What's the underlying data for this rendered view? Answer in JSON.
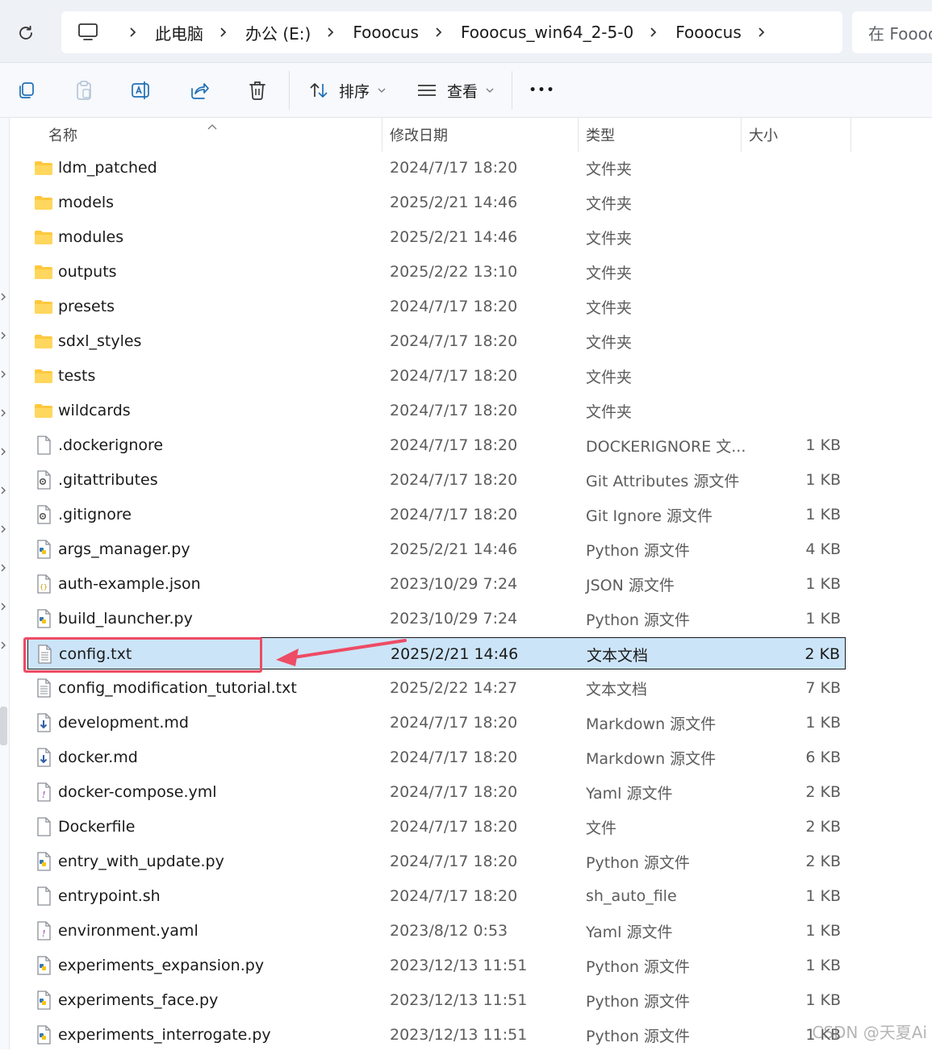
{
  "address_bar": {
    "crumbs": [
      "此电脑",
      "办公 (E:)",
      "Fooocus",
      "Fooocus_win64_2-5-0",
      "Fooocus"
    ],
    "search_placeholder": "在 Fooocus 中搜索"
  },
  "toolbar": {
    "sort_label": "排序",
    "view_label": "查看",
    "more_label": "•••"
  },
  "columns": {
    "name": "名称",
    "date": "修改日期",
    "type": "类型",
    "size": "大小"
  },
  "files": [
    {
      "name": "ldm_patched",
      "date": "2024/7/17 18:20",
      "type": "文件夹",
      "size": "",
      "icon": "folder-icon"
    },
    {
      "name": "models",
      "date": "2025/2/21 14:46",
      "type": "文件夹",
      "size": "",
      "icon": "folder-icon"
    },
    {
      "name": "modules",
      "date": "2025/2/21 14:46",
      "type": "文件夹",
      "size": "",
      "icon": "folder-icon"
    },
    {
      "name": "outputs",
      "date": "2025/2/22 13:10",
      "type": "文件夹",
      "size": "",
      "icon": "folder-icon"
    },
    {
      "name": "presets",
      "date": "2024/7/17 18:20",
      "type": "文件夹",
      "size": "",
      "icon": "folder-icon"
    },
    {
      "name": "sdxl_styles",
      "date": "2024/7/17 18:20",
      "type": "文件夹",
      "size": "",
      "icon": "folder-icon"
    },
    {
      "name": "tests",
      "date": "2024/7/17 18:20",
      "type": "文件夹",
      "size": "",
      "icon": "folder-icon"
    },
    {
      "name": "wildcards",
      "date": "2024/7/17 18:20",
      "type": "文件夹",
      "size": "",
      "icon": "folder-icon"
    },
    {
      "name": ".dockerignore",
      "date": "2024/7/17 18:20",
      "type": "DOCKERIGNORE 文...",
      "size": "1 KB",
      "icon": "blank-file-icon"
    },
    {
      "name": ".gitattributes",
      "date": "2024/7/17 18:20",
      "type": "Git Attributes 源文件",
      "size": "1 KB",
      "icon": "gear-file-icon"
    },
    {
      "name": ".gitignore",
      "date": "2024/7/17 18:20",
      "type": "Git Ignore 源文件",
      "size": "1 KB",
      "icon": "gear-file-icon"
    },
    {
      "name": "args_manager.py",
      "date": "2025/2/21 14:46",
      "type": "Python 源文件",
      "size": "4 KB",
      "icon": "python-file-icon"
    },
    {
      "name": "auth-example.json",
      "date": "2023/10/29 7:24",
      "type": "JSON 源文件",
      "size": "1 KB",
      "icon": "json-file-icon"
    },
    {
      "name": "build_launcher.py",
      "date": "2023/10/29 7:24",
      "type": "Python 源文件",
      "size": "1 KB",
      "icon": "python-file-icon"
    },
    {
      "name": "config.txt",
      "date": "2025/2/21 14:46",
      "type": "文本文档",
      "size": "2 KB",
      "icon": "text-file-icon",
      "selected": true
    },
    {
      "name": "config_modification_tutorial.txt",
      "date": "2025/2/22 14:27",
      "type": "文本文档",
      "size": "7 KB",
      "icon": "text-file-icon"
    },
    {
      "name": "development.md",
      "date": "2024/7/17 18:20",
      "type": "Markdown 源文件",
      "size": "1 KB",
      "icon": "markdown-file-icon"
    },
    {
      "name": "docker.md",
      "date": "2024/7/17 18:20",
      "type": "Markdown 源文件",
      "size": "6 KB",
      "icon": "markdown-file-icon"
    },
    {
      "name": "docker-compose.yml",
      "date": "2024/7/17 18:20",
      "type": "Yaml 源文件",
      "size": "2 KB",
      "icon": "yaml-file-icon"
    },
    {
      "name": "Dockerfile",
      "date": "2024/7/17 18:20",
      "type": "文件",
      "size": "2 KB",
      "icon": "blank-file-icon"
    },
    {
      "name": "entry_with_update.py",
      "date": "2024/7/17 18:20",
      "type": "Python 源文件",
      "size": "2 KB",
      "icon": "python-file-icon"
    },
    {
      "name": "entrypoint.sh",
      "date": "2024/7/17 18:20",
      "type": "sh_auto_file",
      "size": "1 KB",
      "icon": "blank-file-icon"
    },
    {
      "name": "environment.yaml",
      "date": "2023/8/12 0:53",
      "type": "Yaml 源文件",
      "size": "1 KB",
      "icon": "yaml-file-icon"
    },
    {
      "name": "experiments_expansion.py",
      "date": "2023/12/13 11:51",
      "type": "Python 源文件",
      "size": "1 KB",
      "icon": "python-file-icon"
    },
    {
      "name": "experiments_face.py",
      "date": "2023/12/13 11:51",
      "type": "Python 源文件",
      "size": "1 KB",
      "icon": "python-file-icon"
    },
    {
      "name": "experiments_interrogate.py",
      "date": "2023/12/13 11:51",
      "type": "Python 源文件",
      "size": "1 KB",
      "icon": "python-file-icon"
    }
  ],
  "watermark": "CSDN @天夏Ai",
  "colors": {
    "selection_bg": "#cce4f7",
    "annotation": "#ee4b64",
    "folder": "#ffc83d"
  }
}
